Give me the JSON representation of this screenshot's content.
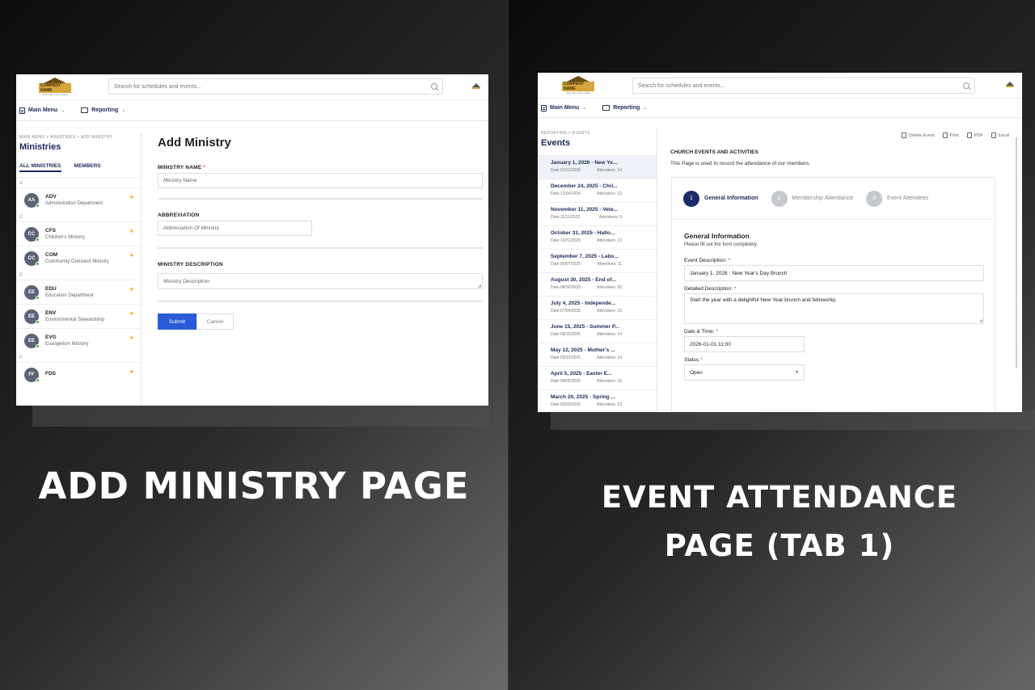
{
  "left": {
    "header": {
      "search_placeholder": "Search for schedules and events..."
    },
    "logo": {
      "name": "COMPANY NAME",
      "tagline": "TAGLINE GOES HERE"
    },
    "menu": {
      "main": "Main Menu",
      "reporting": "Reporting"
    },
    "sidebar": {
      "breadcrumb": "MAIN MENU > MINISTRIES > ADD MINISTRY",
      "title": "Ministries",
      "tabs": [
        "ALL MINISTRIES",
        "MEMBERS"
      ],
      "groups": [
        {
          "letter": "A",
          "items": [
            {
              "initials": "AA",
              "code": "ADV",
              "desc": "Administration Department"
            }
          ]
        },
        {
          "letter": "C",
          "items": [
            {
              "initials": "CC",
              "code": "CFS",
              "desc": "Children's Ministry"
            },
            {
              "initials": "CC",
              "code": "COM",
              "desc": "Community Outreach Ministry"
            }
          ]
        },
        {
          "letter": "E",
          "items": [
            {
              "initials": "EE",
              "code": "EDU",
              "desc": "Education Department"
            },
            {
              "initials": "EE",
              "code": "ENV",
              "desc": "Environmental Stewardship"
            },
            {
              "initials": "EE",
              "code": "EVG",
              "desc": "Evangelism Ministry"
            }
          ]
        },
        {
          "letter": "F",
          "items": [
            {
              "initials": "FF",
              "code": "FDS",
              "desc": ""
            }
          ]
        }
      ]
    },
    "form": {
      "title": "Add Ministry",
      "name_label": "MINISTRY NAME",
      "name_placeholder": "Ministry Name",
      "abbr_label": "ABBREVIATION",
      "abbr_placeholder": "Abbreviation Of Ministry",
      "desc_label": "MINISTRY DESCRIPTION",
      "desc_placeholder": "Ministry Description",
      "submit": "Submit",
      "cancel": "Cancel"
    },
    "caption": "ADD MINISTRY PAGE"
  },
  "right": {
    "header": {
      "search_placeholder": "Search for schedules and events..."
    },
    "logo": {
      "name": "COMPANY NAME",
      "tagline": "TAGLINE GOES HERE"
    },
    "menu": {
      "main": "Main Menu",
      "reporting": "Reporting"
    },
    "sidebar": {
      "breadcrumb": "REPORTING > EVENTS",
      "title": "Events",
      "events": [
        {
          "title": "January 1, 2026 - New Ye...",
          "date": "Date:01/01/2026",
          "att": "Attendees: 14"
        },
        {
          "title": "December 24, 2025 - Chri...",
          "date": "Date:12/24/2025",
          "att": "Attendees: 12"
        },
        {
          "title": "November 11, 2025 - Vete...",
          "date": "Date:11/11/2025",
          "att": "Attendees: 9"
        },
        {
          "title": "October 31, 2025 - Hallo...",
          "date": "Date:10/31/2025",
          "att": "Attendees: 13"
        },
        {
          "title": "September 7, 2025 - Labo...",
          "date": "Date:09/07/2025",
          "att": "Attendees: 11"
        },
        {
          "title": "August 30, 2025 - End of...",
          "date": "Date:08/30/2025",
          "att": "Attendees: 20"
        },
        {
          "title": "July 4, 2025 - Independe...",
          "date": "Date:07/04/2025",
          "att": "Attendees: 15"
        },
        {
          "title": "June 15, 2025 - Summer P...",
          "date": "Date:06/15/2025",
          "att": "Attendees: 14"
        },
        {
          "title": "May 12, 2025 - Mother's ...",
          "date": "Date:05/12/2025",
          "att": "Attendees: 14"
        },
        {
          "title": "April 5, 2025 - Easter E...",
          "date": "Date:04/05/2025",
          "att": "Attendees: 15"
        },
        {
          "title": "March 20, 2025 - Spring ...",
          "date": "Date:03/20/2025",
          "att": "Attendees: 13"
        }
      ]
    },
    "toolbar": {
      "delete": "Delete Event",
      "print": "Print",
      "pdf": "PDF",
      "excel": "Excel"
    },
    "main": {
      "heading": "CHURCH EVENTS AND ACTIVITIES",
      "subheading": "This Page is used to record the attendance of our members.",
      "steps": [
        {
          "num": "1",
          "label": "General Information"
        },
        {
          "num": "2",
          "label": "Membership Attendance"
        },
        {
          "num": "3",
          "label": "Event Attendees"
        }
      ],
      "section_title": "General Information",
      "section_sub": "Please fill out the form completely.",
      "event_desc_label": "Event Description:",
      "event_desc_value": "January 1, 2026 - New Year's Day Brunch",
      "detail_label": "Detailed Description:",
      "detail_value": "Start the year with a delightful New Year brunch and fellowship.",
      "datetime_label": "Date & Time:",
      "datetime_value": "2026-01-01 11:00",
      "status_label": "Status",
      "status_value": "Open"
    },
    "caption_line1": "EVENT ATTENDANCE",
    "caption_line2": "PAGE (TAB 1)"
  }
}
